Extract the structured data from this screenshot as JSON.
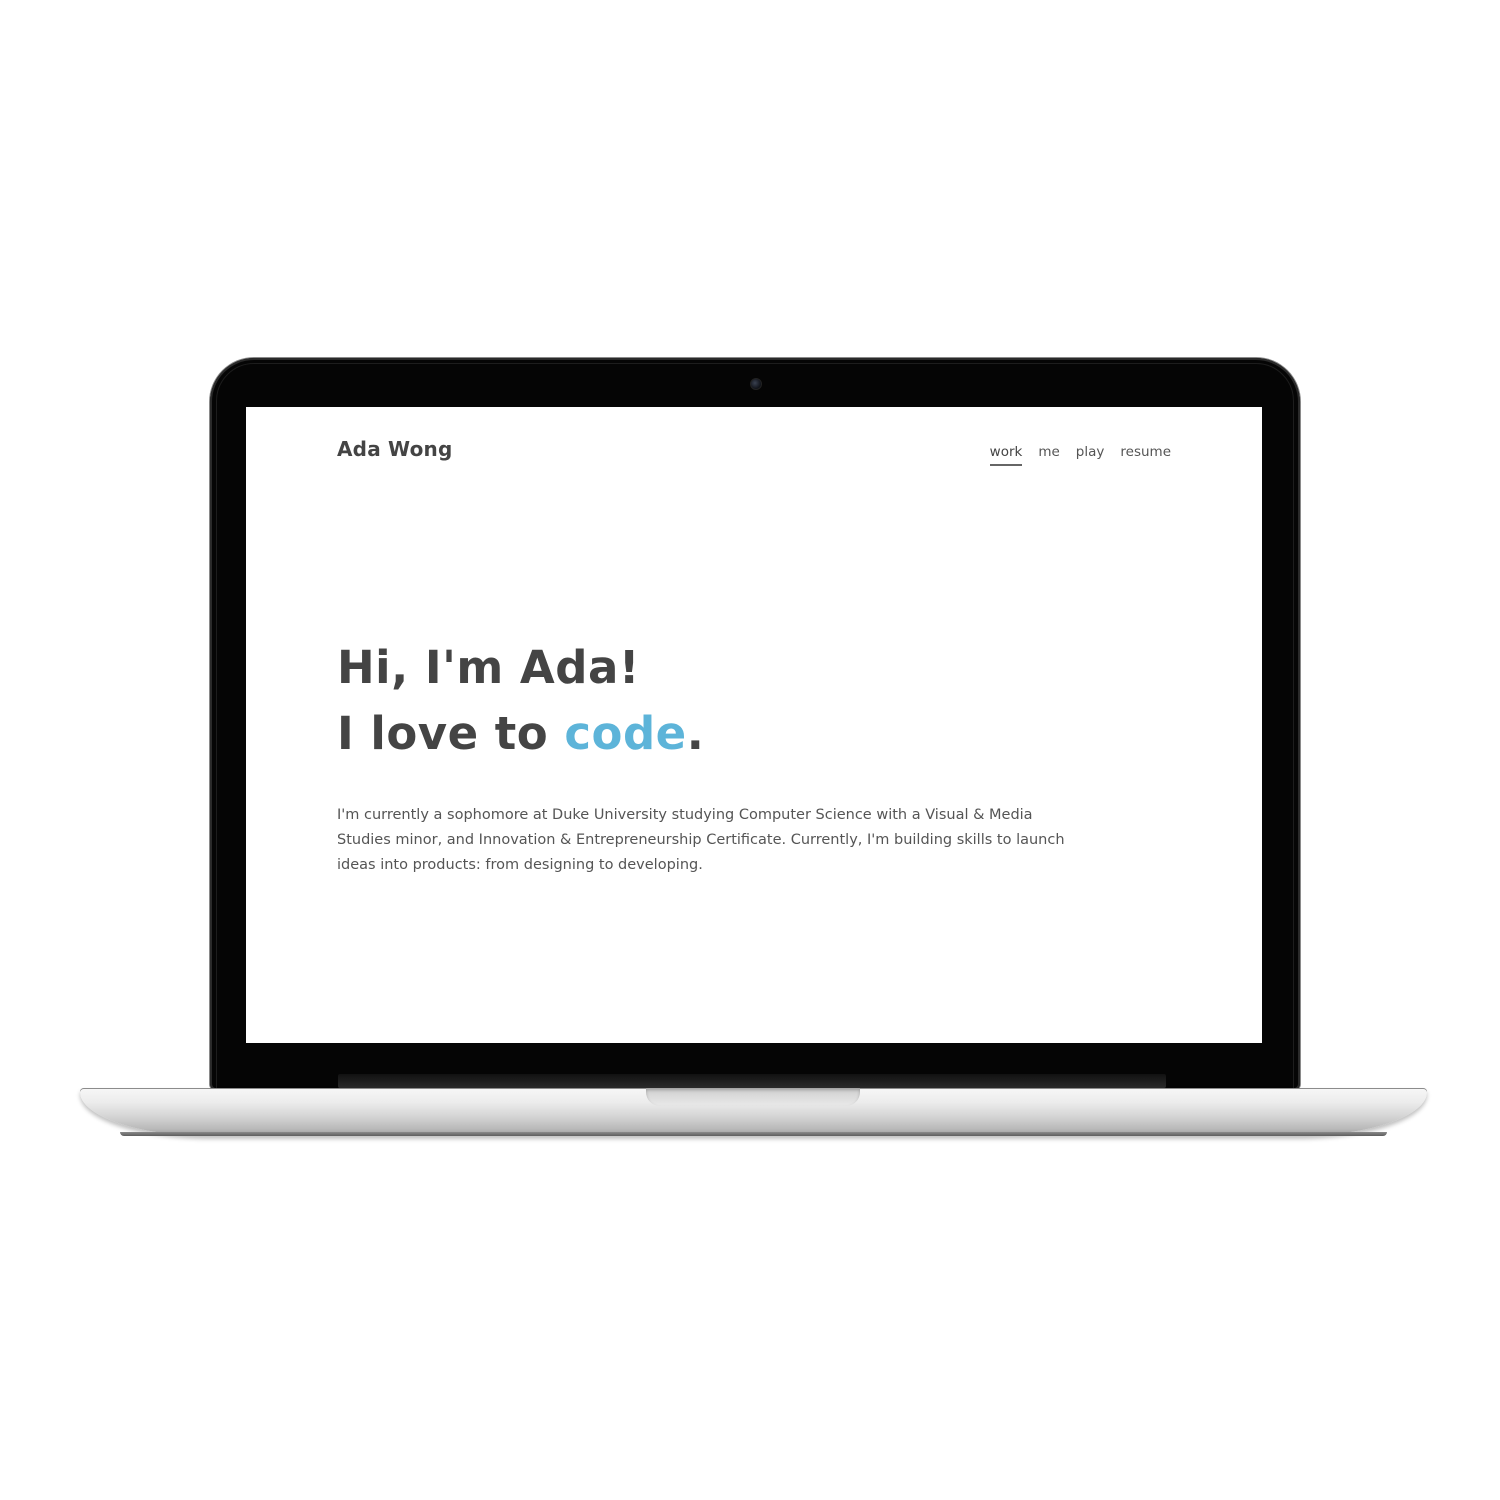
{
  "site": {
    "brand": "Ada Wong",
    "nav": [
      {
        "label": "work",
        "active": true
      },
      {
        "label": "me",
        "active": false
      },
      {
        "label": "play",
        "active": false
      },
      {
        "label": "resume",
        "active": false
      }
    ]
  },
  "hero": {
    "line1": "Hi, I'm Ada!",
    "line2_prefix": "I love to ",
    "line2_accent": "code",
    "line2_suffix": "."
  },
  "intro": {
    "text": "I'm currently a sophomore at Duke University studying Computer Science with a Visual & Media Studies minor, and Innovation & Entrepreneurship Certificate. Currently, I'm building skills to launch ideas into products: from designing to developing."
  },
  "colors": {
    "text": "#444444",
    "accent": "#5db4d9",
    "background": "#ffffff",
    "bezel": "#050505"
  }
}
